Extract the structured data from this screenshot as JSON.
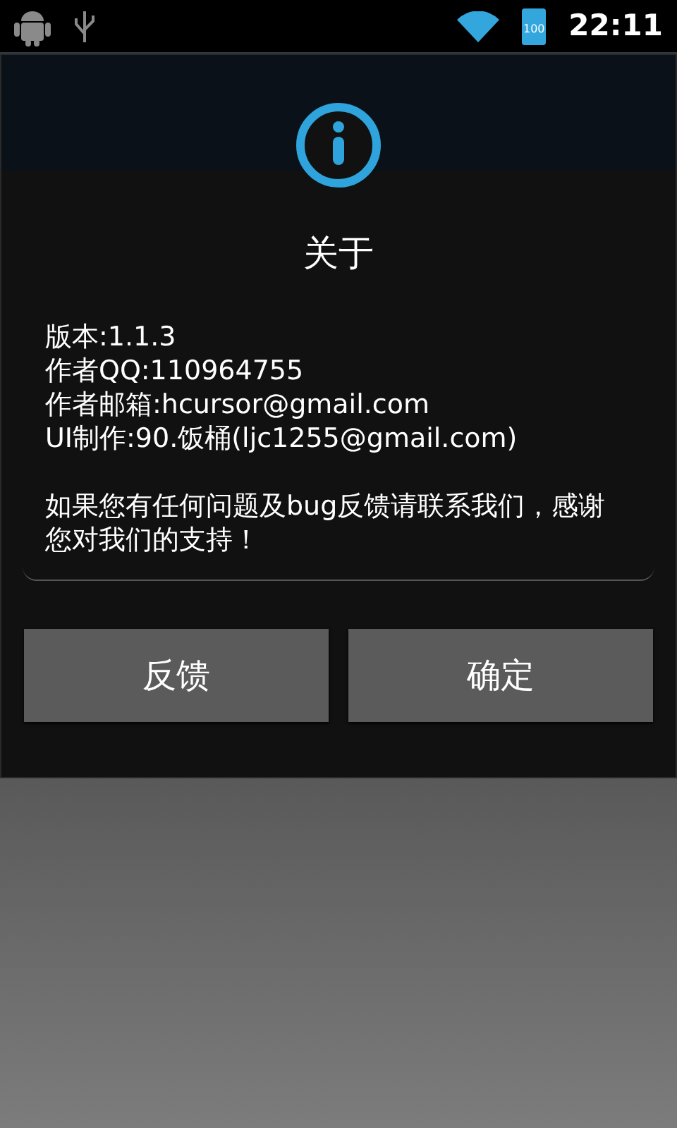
{
  "status_bar": {
    "time": "22:11",
    "battery": "100"
  },
  "dialog": {
    "title": "关于",
    "lines": [
      "版本:1.1.3",
      "作者QQ:110964755",
      "作者邮箱:hcursor@gmail.com",
      "UI制作:90.饭桶(ljc1255@gmail.com)"
    ],
    "message": "如果您有任何问题及bug反馈请联系我们，感谢您对我们的支持！",
    "buttons": [
      {
        "label": "反馈"
      },
      {
        "label": "确定"
      }
    ]
  }
}
